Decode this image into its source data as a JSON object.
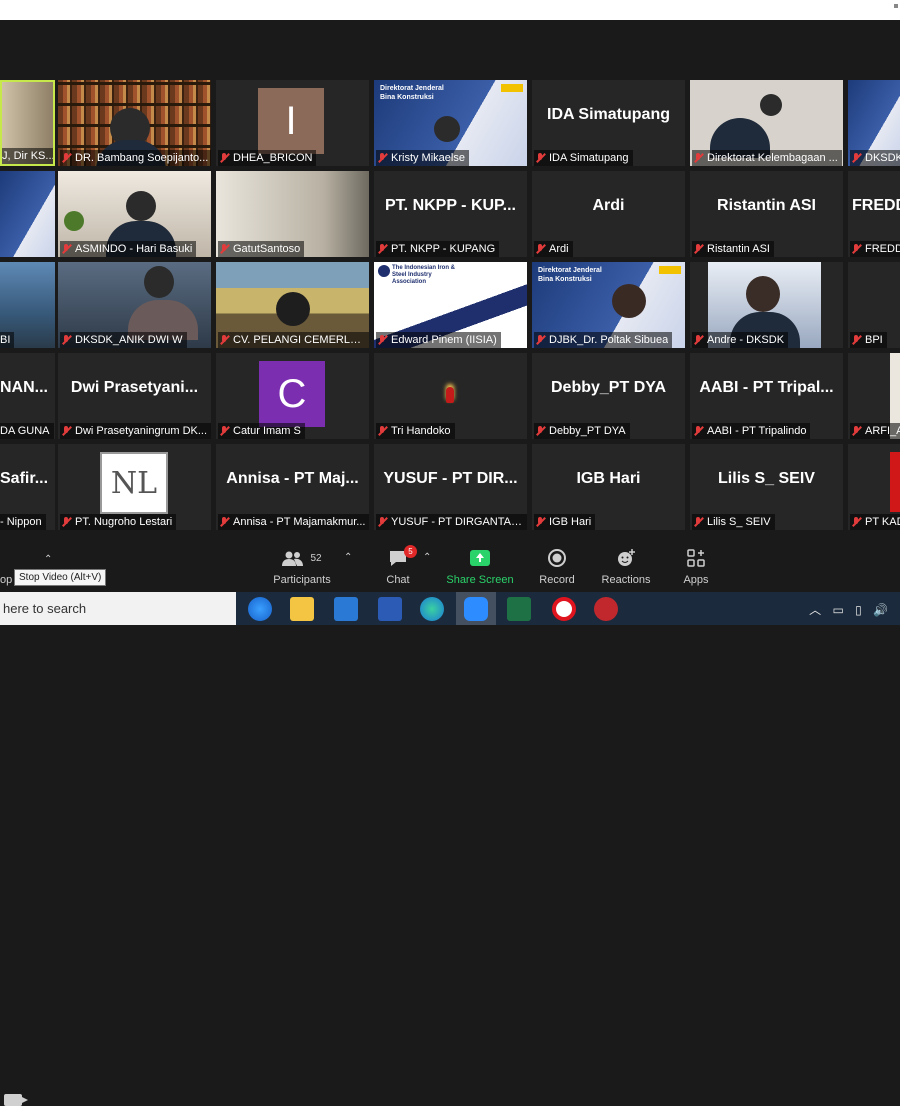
{
  "participants": [
    {
      "name": "DR. Bambang Soepijanto...",
      "muted": true
    },
    {
      "name": "DHEA_BRICON",
      "muted": true,
      "avatar_letter": "I",
      "avatar_color": "#8b6a5a"
    },
    {
      "name": "Kristy Mikaelse",
      "muted": true
    },
    {
      "name": "IDA Simatupang",
      "muted": true,
      "display_name": "IDA Simatupang"
    },
    {
      "name": "Direktorat Kelembagaan ...",
      "muted": true
    },
    {
      "name": "DKSDK",
      "muted": true
    },
    {
      "name": "ASMINDO - Hari Basuki",
      "muted": true
    },
    {
      "name": "GatutSantoso",
      "muted": true
    },
    {
      "name": "PT. NKPP - KUPANG",
      "muted": true,
      "display_name": "PT. NKPP - KUP..."
    },
    {
      "name": "Ardi",
      "muted": true,
      "display_name": "Ardi"
    },
    {
      "name": "Ristantin ASI",
      "muted": true,
      "display_name": "Ristantin ASI"
    },
    {
      "name": "FREDD",
      "muted": true,
      "display_name": "FREDD"
    },
    {
      "name": "BI",
      "muted": false
    },
    {
      "name": "DKSDK_ANIK DWI W",
      "muted": true
    },
    {
      "name": "CV. PELANGI CEMERLAN...",
      "muted": true
    },
    {
      "name": "Edward Pinem (IISIA)",
      "muted": true
    },
    {
      "name": "DJBK_Dr. Poltak Sibuea",
      "muted": true
    },
    {
      "name": "Andre - DKSDK",
      "muted": true
    },
    {
      "name": "BPI",
      "muted": true
    },
    {
      "name": "DA GUNA",
      "muted": false,
      "display_name": "NAN..."
    },
    {
      "name": "Dwi Prasetyaningrum DK...",
      "muted": true,
      "display_name": "Dwi Prasetyani..."
    },
    {
      "name": "Catur Imam S",
      "muted": true,
      "avatar_letter": "C",
      "avatar_color": "#7b2fb0"
    },
    {
      "name": "Tri Handoko",
      "muted": true
    },
    {
      "name": "Debby_PT DYA",
      "muted": true,
      "display_name": "Debby_PT DYA"
    },
    {
      "name": "AABI - PT Tripalindo",
      "muted": true,
      "display_name": "AABI - PT Tripal..."
    },
    {
      "name": "ARFI_A",
      "muted": true
    },
    {
      "name": "- Nippon",
      "muted": false,
      "display_name": "Safir..."
    },
    {
      "name": "PT. Nugroho Lestari",
      "muted": true
    },
    {
      "name": "Annisa - PT Majamakmur...",
      "muted": true,
      "display_name": "Annisa - PT Maj..."
    },
    {
      "name": "YUSUF - PT DIRGANTARA...",
      "muted": true,
      "display_name": "YUSUF - PT DIR..."
    },
    {
      "name": "IGB Hari",
      "muted": true,
      "display_name": "IGB Hari"
    },
    {
      "name": "Lilis S_ SEIV",
      "muted": true,
      "display_name": "Lilis S_ SEIV"
    },
    {
      "name": "PT KAD",
      "muted": true
    }
  ],
  "first_tile_label": "J, Dir KS...",
  "slide_text": {
    "title": "Direktorat Jenderal Bina Konstruksi",
    "iisia": "The Indonesian Iron & Steel Industry Association"
  },
  "logo_text": {
    "nl": "NL"
  },
  "toolbar": {
    "participants_label": "Participants",
    "participants_count": "52",
    "chat_label": "Chat",
    "chat_badge": "5",
    "share_label": "Share Screen",
    "record_label": "Record",
    "reactions_label": "Reactions",
    "apps_label": "Apps",
    "stop_label": "op",
    "tooltip": "Stop Video (Alt+V)"
  },
  "taskbar": {
    "search_placeholder": "here to search"
  },
  "colors": {
    "share_green": "#2ad26a",
    "muted_red": "#e23b3b",
    "badge_red": "#e02828"
  }
}
